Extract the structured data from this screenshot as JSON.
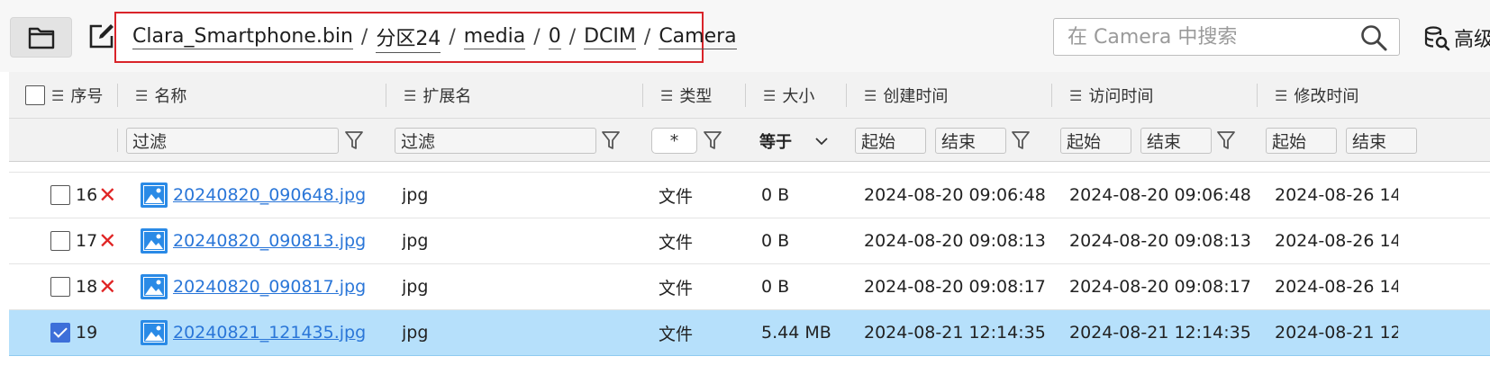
{
  "toolbar": {
    "breadcrumb": [
      "Clara_Smartphone.bin",
      "分区24",
      "media",
      "0",
      "DCIM",
      "Camera"
    ],
    "breadcrumb_sep": "/",
    "search_placeholder": "在 Camera 中搜索",
    "advanced_label": "高级"
  },
  "columns": {
    "index": "序号",
    "name": "名称",
    "ext": "扩展名",
    "type": "类型",
    "size": "大小",
    "created": "创建时间",
    "accessed": "访问时间",
    "modified": "修改时间"
  },
  "filters": {
    "name": "过滤",
    "ext": "过滤",
    "type": "*",
    "size_op": "等于",
    "created_start": "起始",
    "created_end": "结束",
    "accessed_start": "起始",
    "accessed_end": "结束",
    "modified_start": "起始",
    "modified_end": "结束"
  },
  "rows": [
    {
      "index": "16",
      "deleted": true,
      "checked": false,
      "name": "20240820_090648.jpg",
      "ext": "jpg",
      "type": "文件",
      "size": "0 B",
      "created": "2024-08-20 09:06:48",
      "accessed": "2024-08-20 09:06:48",
      "modified": "2024-08-26 14"
    },
    {
      "index": "17",
      "deleted": true,
      "checked": false,
      "name": "20240820_090813.jpg",
      "ext": "jpg",
      "type": "文件",
      "size": "0 B",
      "created": "2024-08-20 09:08:13",
      "accessed": "2024-08-20 09:08:13",
      "modified": "2024-08-26 14"
    },
    {
      "index": "18",
      "deleted": true,
      "checked": false,
      "name": "20240820_090817.jpg",
      "ext": "jpg",
      "type": "文件",
      "size": "0 B",
      "created": "2024-08-20 09:08:17",
      "accessed": "2024-08-20 09:08:17",
      "modified": "2024-08-26 14"
    },
    {
      "index": "19",
      "deleted": false,
      "checked": true,
      "selected": true,
      "name": "20240821_121435.jpg",
      "ext": "jpg",
      "type": "文件",
      "size": "5.44 MB",
      "created": "2024-08-21 12:14:35",
      "accessed": "2024-08-21 12:14:35",
      "modified": "2024-08-21 12"
    }
  ],
  "colors": {
    "highlight_border": "#d9242a",
    "selected_row": "#b6e0fb",
    "link": "#2a76d8",
    "deleted_mark": "#e02424",
    "checkbox_checked": "#3d6fd9"
  }
}
